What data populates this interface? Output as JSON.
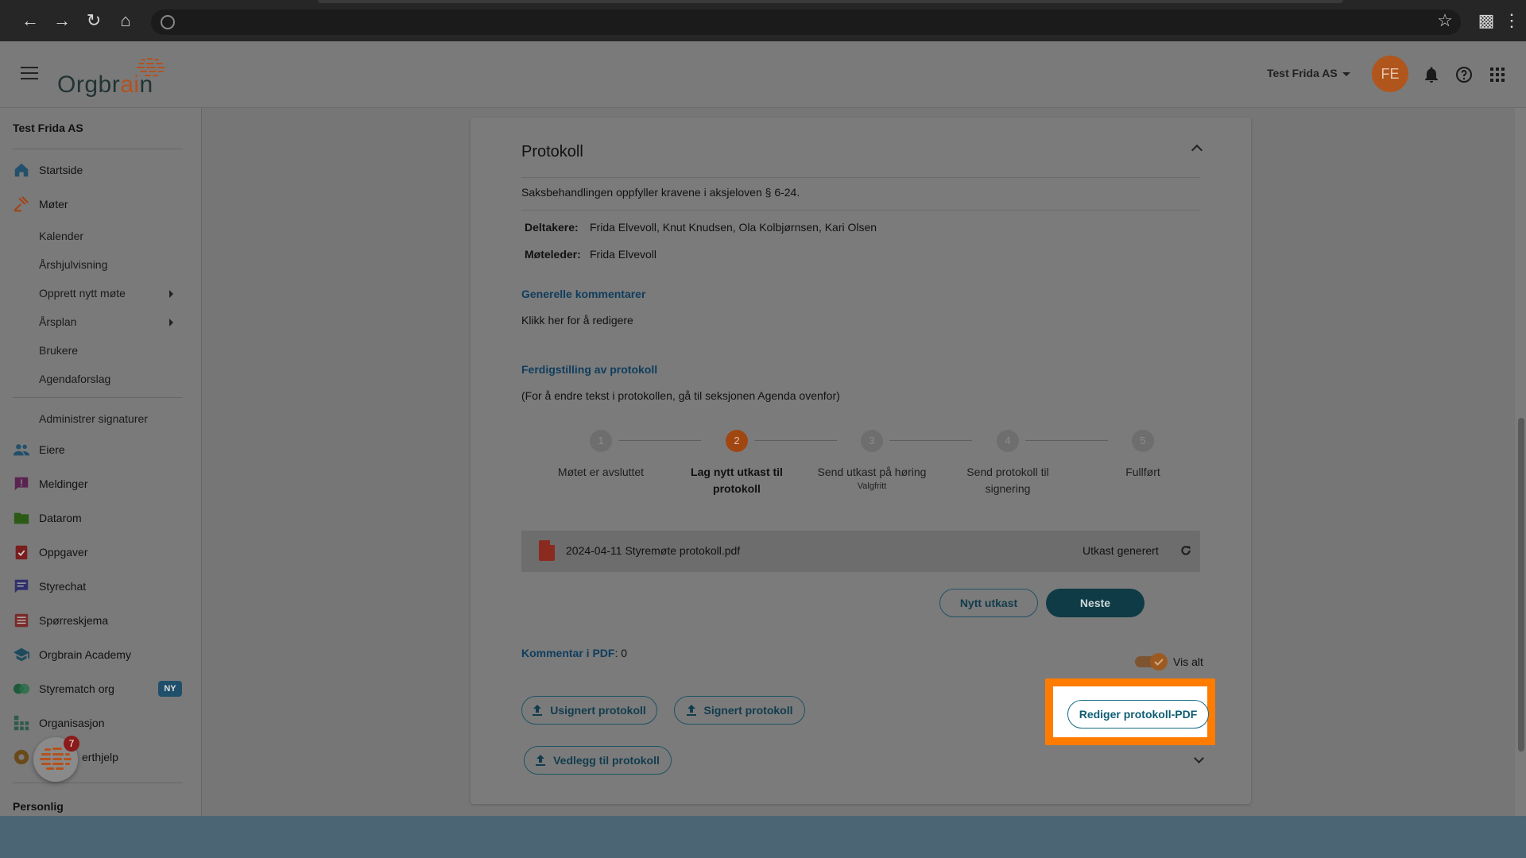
{
  "app": {
    "organization": "Test Frida AS",
    "avatar_initials": "FE",
    "logo_text_part1": "Orgbr",
    "logo_text_part2": "ai",
    "logo_text_part3": "n"
  },
  "sidebar": {
    "org_title": "Test Frida AS",
    "items": [
      {
        "label": "Startside",
        "icon": "home-icon"
      },
      {
        "label": "Møter",
        "icon": "gavel-icon"
      },
      {
        "label": "Eiere",
        "icon": "people-icon"
      },
      {
        "label": "Meldinger",
        "icon": "message-icon"
      },
      {
        "label": "Datarom",
        "icon": "folder-icon"
      },
      {
        "label": "Oppgaver",
        "icon": "task-icon"
      },
      {
        "label": "Styrechat",
        "icon": "chat-icon"
      },
      {
        "label": "Spørreskjema",
        "icon": "survey-icon"
      },
      {
        "label": "Orgbrain Academy",
        "icon": "academy-icon"
      },
      {
        "label": "Styrematch org",
        "icon": "match-icon"
      },
      {
        "label": "Organisasjon",
        "icon": "organization-icon"
      },
      {
        "label": "erthjelp",
        "icon": "help-icon"
      }
    ],
    "sub_items": [
      "Kalender",
      "Årshjulvisning",
      "Opprett nytt møte",
      "Årsplan",
      "Brukere",
      "Agendaforslag"
    ],
    "admin_signatures": "Administrer signaturer",
    "badge_new": "NY",
    "fab_count": "7",
    "section_personal": "Personlig"
  },
  "protocol": {
    "title": "Protokoll",
    "requirement_text": "Saksbehandlingen oppfyller kravene i aksjeloven § 6-24.",
    "participants_label": "Deltakere:",
    "participants_value": "Frida Elvevoll, Knut Knudsen, Ola Kolbjørnsen, Kari Olsen",
    "leader_label": "Møteleder:",
    "leader_value": "Frida Elvevoll",
    "general_comments_heading": "Generelle kommentarer",
    "general_comments_text": "Klikk her for å redigere",
    "finalize_heading": "Ferdigstilling av protokoll",
    "finalize_note": "(For å endre tekst i protokollen, gå til seksjonen Agenda ovenfor)",
    "steps": [
      {
        "number": "1",
        "label": "Møtet er avsluttet",
        "sub": ""
      },
      {
        "number": "2",
        "label": "Lag nytt utkast til protokoll",
        "sub": ""
      },
      {
        "number": "3",
        "label": "Send utkast på høring",
        "sub": "Valgfritt"
      },
      {
        "number": "4",
        "label": "Send protokoll til signering",
        "sub": ""
      },
      {
        "number": "5",
        "label": "Fullført",
        "sub": ""
      }
    ],
    "active_step": 2,
    "file_name": "2024-04-11 Styremøte protokoll.pdf",
    "file_status": "Utkast generert",
    "btn_new_draft": "Nytt utkast",
    "btn_next": "Neste",
    "comment_pdf_label": "Kommentar i PDF",
    "comment_pdf_count": ": 0",
    "toggle_label": "Vis alt",
    "btn_unsigned": "Usignert protokoll",
    "btn_signed": "Signert protokoll",
    "btn_attachment": "Vedlegg til protokoll",
    "btn_edit_pdf": "Rediger protokoll-PDF"
  },
  "colors": {
    "highlight": "#ff7c00",
    "accent_orange": "#a04611",
    "teal": "#0e3b46"
  }
}
